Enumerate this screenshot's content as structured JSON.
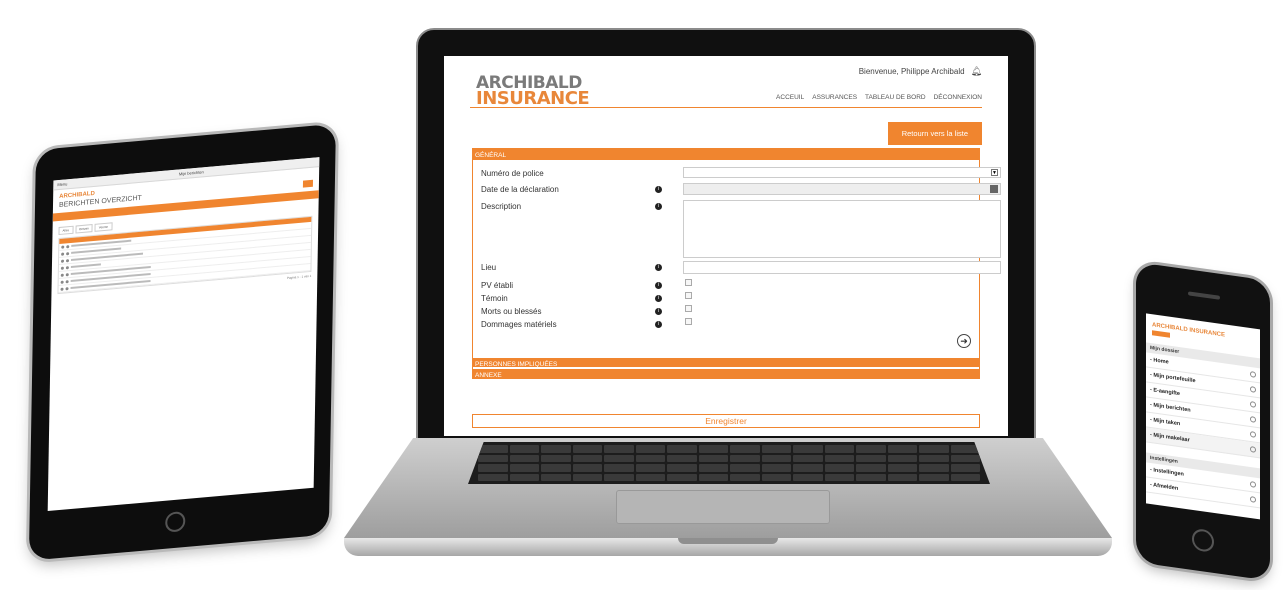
{
  "tablet": {
    "bar_left": "Menu",
    "bar_title": "Mijn berichten",
    "logo": "ARCHIBALD",
    "heading": "BERICHTEN OVERZICHT",
    "tabs": [
      "Alles",
      "Ontvan",
      "Verzon"
    ],
    "footer": "Pagina 1 - 1 van 1"
  },
  "laptop": {
    "logo_line1": "ARCHIBALD",
    "logo_line2": "INSURANCE",
    "welcome": "Bienvenue, Philippe Archibald",
    "nav": [
      "ACCEUIL",
      "ASSURANCES",
      "TABLEAU DE BORD",
      "DÉCONNEXION"
    ],
    "back_button": "Retourn vers la liste",
    "section_general": "GÉNÉRAL",
    "fields": {
      "policy_number": "Numéro de police",
      "declaration_date": "Date de la déclaration",
      "description": "Description",
      "location": "Lieu",
      "pv": "PV établi",
      "witness": "Témoin",
      "casualties": "Morts ou blessés",
      "damage": "Dommages matériels"
    },
    "section_people": "PERSONNES IMPLIQUÉES",
    "section_annex": "ANNEXE",
    "save_button": "Enregistrer"
  },
  "phone": {
    "logo": "ARCHIBALD INSURANCE",
    "section_dossier": "Mijn dossier",
    "items": [
      "- Home",
      "- Mijn portefeuille",
      "- E-aangifte",
      "- Mijn berichten",
      "- Mijn taken",
      "- Mijn makelaar"
    ],
    "section_settings": "Instellingen",
    "settings_items": [
      "- Instellingen",
      "- Afmelden"
    ]
  }
}
